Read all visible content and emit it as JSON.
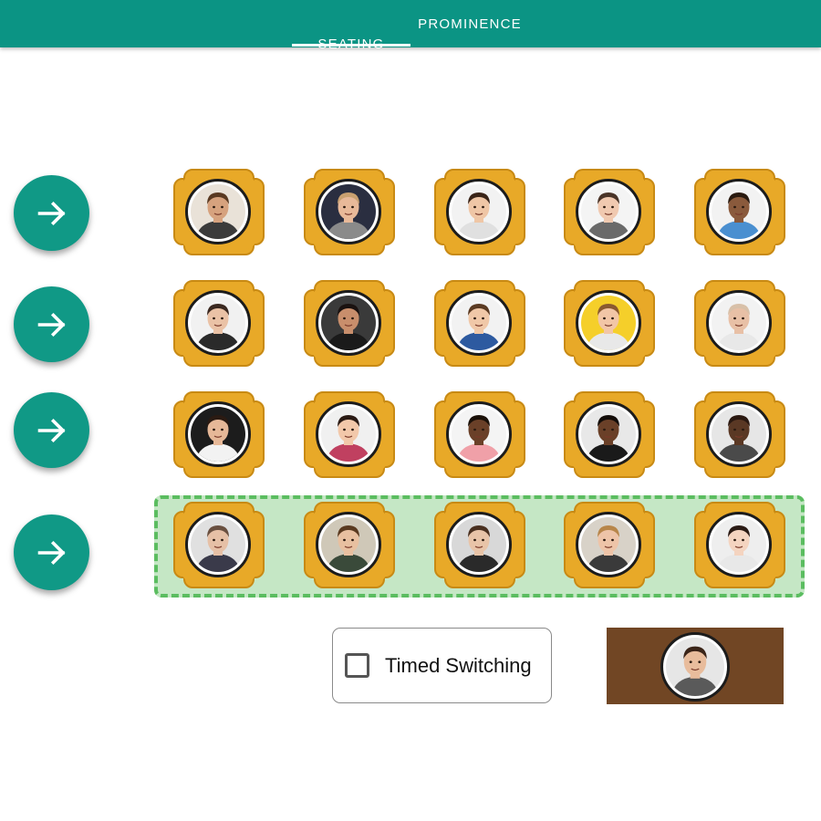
{
  "tabs": [
    {
      "label": "SEATING",
      "active": true
    },
    {
      "label": "PROMINENCE",
      "active": false
    }
  ],
  "colors": {
    "appbar": "#0b9484",
    "arrow_button": "#109986",
    "chair": "#e8a928",
    "chair_outline": "#c88a14",
    "highlight_fill": "#c5e7c5",
    "highlight_border": "#5bbd60",
    "presenter_panel": "#714624"
  },
  "row_buttons": [
    {
      "icon": "arrow-right-icon"
    },
    {
      "icon": "arrow-right-icon"
    },
    {
      "icon": "arrow-right-icon"
    },
    {
      "icon": "arrow-right-icon"
    }
  ],
  "active_row": 4,
  "seating": [
    [
      {
        "avatar": "man-phone-avatar",
        "skin": "#d6a27e",
        "hair": "#5a3a22",
        "bg": "#e9e2d8",
        "shirt": "#3b3b3b"
      },
      {
        "avatar": "man-sunglasses-avatar",
        "skin": "#e8b999",
        "hair": "#c9a070",
        "bg": "#2a2e40",
        "shirt": "#8a8a8a"
      },
      {
        "avatar": "man-thinking-avatar",
        "skin": "#efc6a6",
        "hair": "#3a2418",
        "bg": "#f2f2f2",
        "shirt": "#e0e0e0"
      },
      {
        "avatar": "woman-headache-avatar",
        "skin": "#f0c9b0",
        "hair": "#4a3428",
        "bg": "#f4f4f4",
        "shirt": "#6a6a6a"
      },
      {
        "avatar": "man-smiling-avatar",
        "skin": "#8a5a3c",
        "hair": "#2a1a10",
        "bg": "#f2f2f2",
        "shirt": "#4a8fd0"
      }
    ],
    [
      {
        "avatar": "man-scratching-head-avatar",
        "skin": "#eac2a6",
        "hair": "#3a2820",
        "bg": "#f1f1f1",
        "shirt": "#2a2a2a"
      },
      {
        "avatar": "woman-dark-hair-avatar",
        "skin": "#c88e6c",
        "hair": "#1a1210",
        "bg": "#3a3a3a",
        "shirt": "#1a1a1a"
      },
      {
        "avatar": "man-bored-avatar",
        "skin": "#f0c8a8",
        "hair": "#5a3a22",
        "bg": "#f2f2f2",
        "shirt": "#2d5aa0"
      },
      {
        "avatar": "man-yellow-bg-avatar",
        "skin": "#f2c6a6",
        "hair": "#8a5a30",
        "bg": "#f5cf2a",
        "shirt": "#e8e8e8"
      },
      {
        "avatar": "man-bald-tired-avatar",
        "skin": "#e8c0a6",
        "hair": "#d8c0a8",
        "bg": "#f2f2f2",
        "shirt": "#e8e8e8"
      }
    ],
    [
      {
        "avatar": "young-man-dark-bg-avatar",
        "skin": "#e6b898",
        "hair": "#2a1a12",
        "bg": "#1c1c1c",
        "shirt": "#f2f2f2"
      },
      {
        "avatar": "woman-smiling-avatar",
        "skin": "#f2c8aa",
        "hair": "#2a1a14",
        "bg": "#f0f0f0",
        "shirt": "#c04060"
      },
      {
        "avatar": "man-pink-shirt-avatar",
        "skin": "#6a4028",
        "hair": "#1a1008",
        "bg": "#f4f4f4",
        "shirt": "#f0a0a8"
      },
      {
        "avatar": "woman-curly-hair-avatar",
        "skin": "#6a4028",
        "hair": "#120c08",
        "bg": "#e8e8e8",
        "shirt": "#1a1a1a"
      },
      {
        "avatar": "man-bald-dark-avatar",
        "skin": "#5a3824",
        "hair": "#2a1810",
        "bg": "#e6e6e6",
        "shirt": "#4a4a4a"
      }
    ],
    [
      {
        "avatar": "man-glasses-avatar",
        "skin": "#e6c0a6",
        "hair": "#6a5040",
        "bg": "#e0e0e0",
        "shirt": "#3a3a4a"
      },
      {
        "avatar": "man-messy-hair-avatar",
        "skin": "#e8c0a0",
        "hair": "#5a3a20",
        "bg": "#cfc8b8",
        "shirt": "#3a4a3a"
      },
      {
        "avatar": "man-short-hair-avatar",
        "skin": "#e8c4a8",
        "hair": "#4a3020",
        "bg": "#d8d8d8",
        "shirt": "#2a2a2a"
      },
      {
        "avatar": "woman-blonde-avatar",
        "skin": "#eec4a8",
        "hair": "#b8864a",
        "bg": "#d8d2c8",
        "shirt": "#3a3a3a"
      },
      {
        "avatar": "woman-asian-avatar",
        "skin": "#f4d4c0",
        "hair": "#2a1a14",
        "bg": "#eeeeee",
        "shirt": "#e8e8e8"
      }
    ]
  ],
  "timed_switching": {
    "label": "Timed Switching",
    "checked": false
  },
  "presenter": {
    "avatar": "woman-presenter-avatar",
    "skin": "#e8bc9c",
    "hair": "#3a2418",
    "bg": "#e6e6e6",
    "shirt": "#5a5a5a"
  }
}
